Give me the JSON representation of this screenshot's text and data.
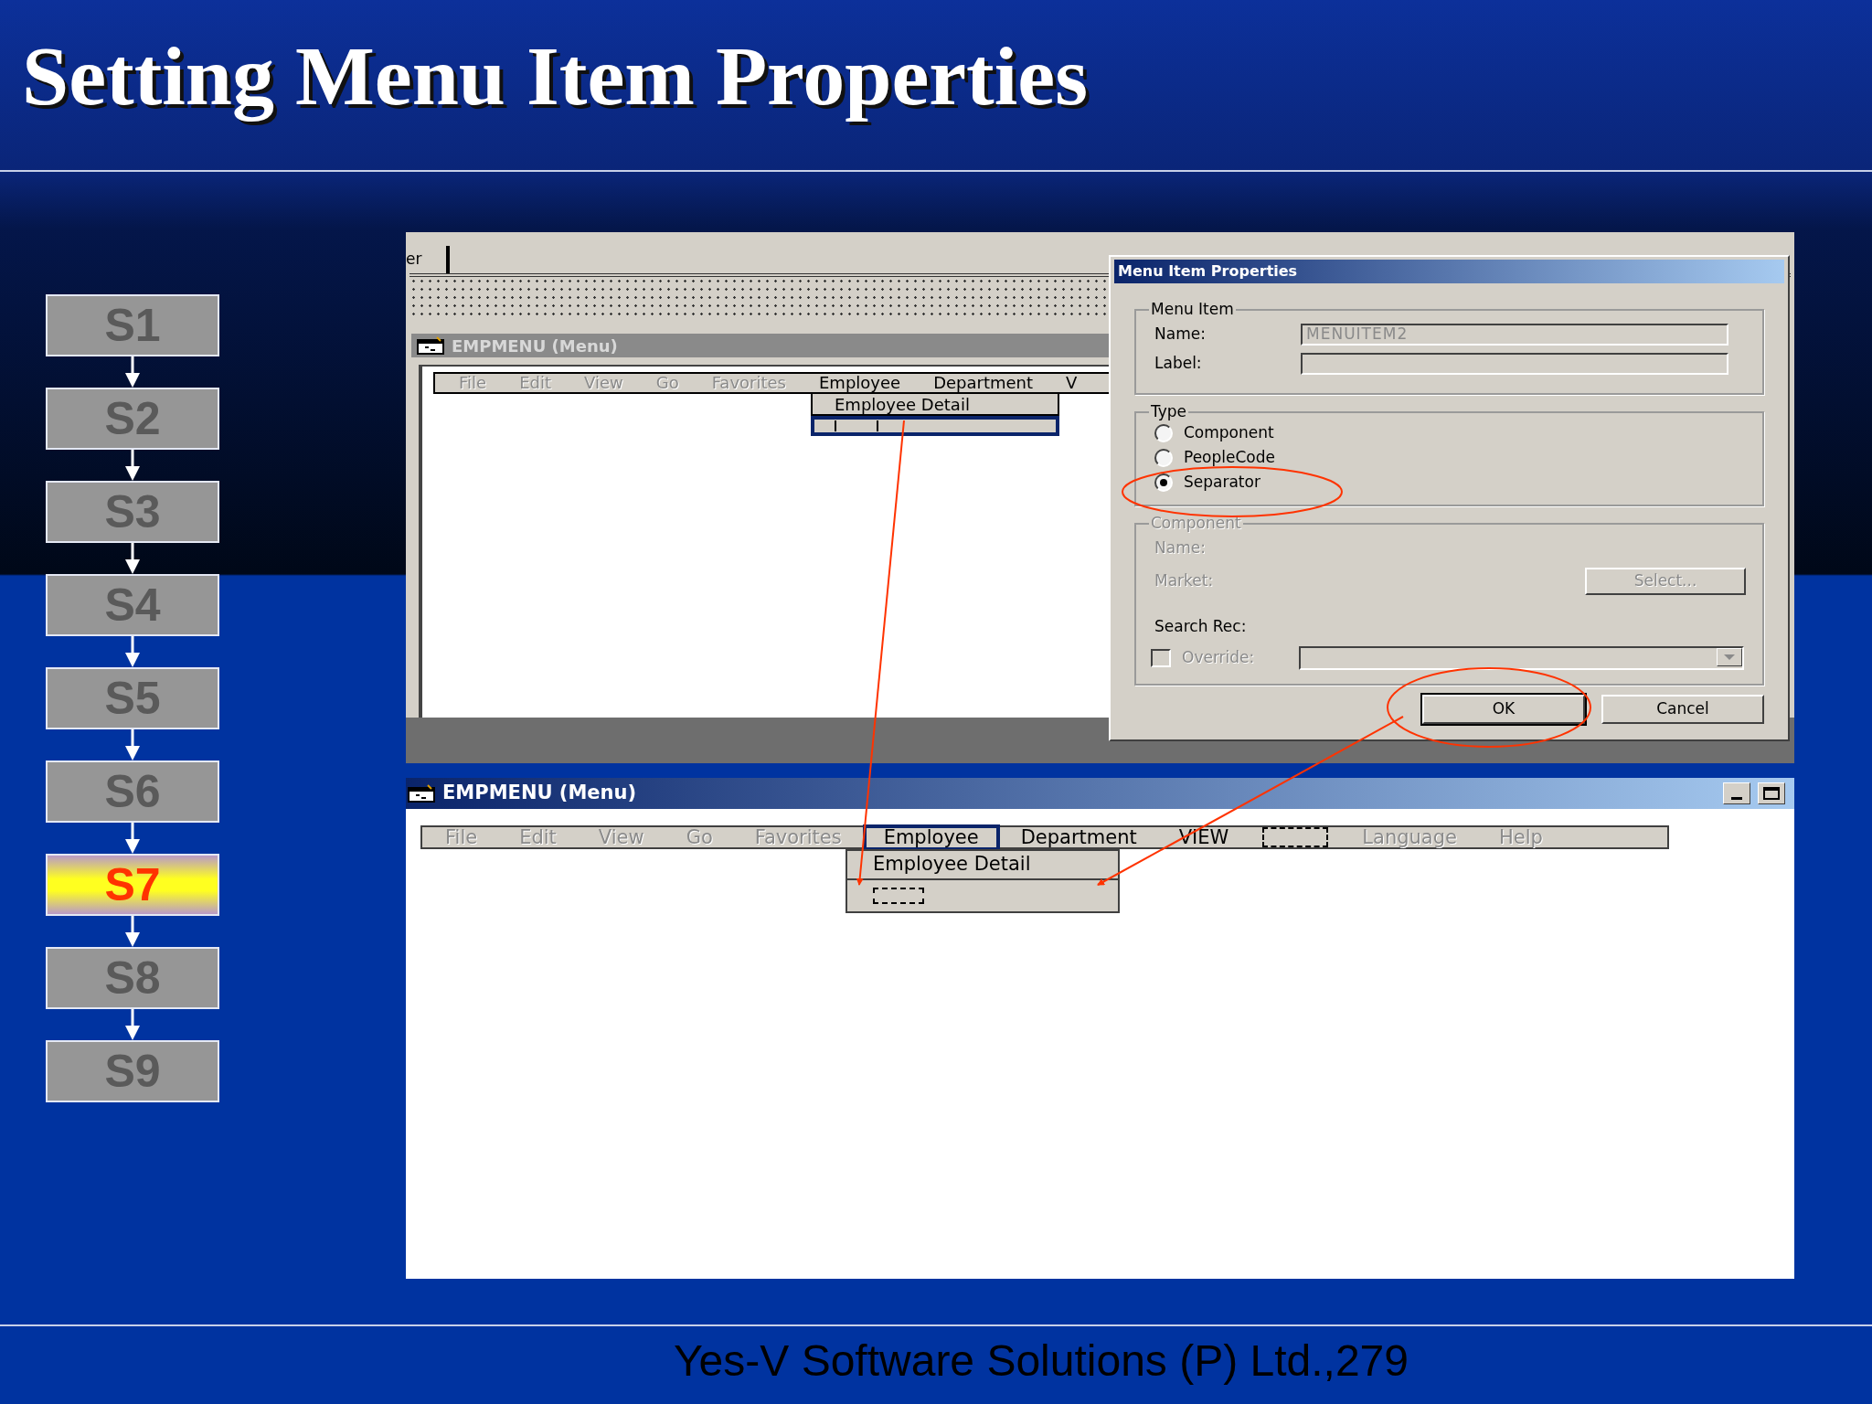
{
  "slide": {
    "title": "Setting Menu Item Properties",
    "footer": "Yes-V Software Solutions (P) Ltd.,279"
  },
  "steps": [
    {
      "label": "S1",
      "selected": false
    },
    {
      "label": "S2",
      "selected": false
    },
    {
      "label": "S3",
      "selected": false
    },
    {
      "label": "S4",
      "selected": false
    },
    {
      "label": "S5",
      "selected": false
    },
    {
      "label": "S6",
      "selected": false
    },
    {
      "label": "S7",
      "selected": true
    },
    {
      "label": "S8",
      "selected": false
    },
    {
      "label": "S9",
      "selected": false
    }
  ],
  "back_window": {
    "tab": "er",
    "title": "EMPMENU (Menu)",
    "menu": [
      {
        "kind": "item",
        "label": "File",
        "disabled": true
      },
      {
        "kind": "item",
        "label": "Edit",
        "disabled": true
      },
      {
        "kind": "item",
        "label": "View",
        "disabled": true
      },
      {
        "kind": "item",
        "label": "Go",
        "disabled": true
      },
      {
        "kind": "item",
        "label": "Favorites",
        "disabled": true
      },
      {
        "kind": "item",
        "label": "Employee",
        "disabled": false
      },
      {
        "kind": "item",
        "label": "Department",
        "disabled": false
      },
      {
        "kind": "item",
        "label": "V",
        "disabled": false
      }
    ],
    "dropdown": [
      {
        "kind": "item",
        "label": "Employee Detail",
        "selected": false
      },
      {
        "kind": "separator",
        "selected": true
      }
    ]
  },
  "dialog": {
    "title": "Menu Item Properties",
    "menu_item": {
      "legend": "Menu Item",
      "name_label": "Name:",
      "name_value": "MENUITEM2",
      "label_label": "Label:"
    },
    "type": {
      "legend": "Type",
      "options": [
        {
          "label": "Component",
          "selected": false
        },
        {
          "label": "PeopleCode",
          "selected": false
        },
        {
          "label": "Separator",
          "selected": true
        }
      ]
    },
    "component": {
      "legend": "Component",
      "disabled": true,
      "name_label": "Name:",
      "market_label": "Market:",
      "select_button": "Select...",
      "search_rec_label": "Search Rec:",
      "override_label": "Override:",
      "override_checked": false
    },
    "buttons": [
      "OK",
      "Cancel"
    ]
  },
  "front_window": {
    "title": "EMPMENU (Menu)",
    "menu": [
      {
        "kind": "item",
        "label": "File",
        "disabled": true,
        "selected": false
      },
      {
        "kind": "item",
        "label": "Edit",
        "disabled": true,
        "selected": false
      },
      {
        "kind": "item",
        "label": "View",
        "disabled": true,
        "selected": false
      },
      {
        "kind": "item",
        "label": "Go",
        "disabled": true,
        "selected": false
      },
      {
        "kind": "item",
        "label": "Favorites",
        "disabled": true,
        "selected": false
      },
      {
        "kind": "item",
        "label": "Employee",
        "disabled": false,
        "selected": true
      },
      {
        "kind": "item",
        "label": "Department",
        "disabled": false,
        "selected": false
      },
      {
        "kind": "item",
        "label": "VIEW",
        "disabled": false,
        "selected": false
      },
      {
        "kind": "separator"
      },
      {
        "kind": "item",
        "label": "Language",
        "disabled": true,
        "selected": false
      },
      {
        "kind": "item",
        "label": "Help",
        "disabled": true,
        "selected": false
      }
    ],
    "dropdown": [
      {
        "kind": "item",
        "label": "Employee Detail"
      },
      {
        "kind": "separator"
      }
    ]
  }
}
